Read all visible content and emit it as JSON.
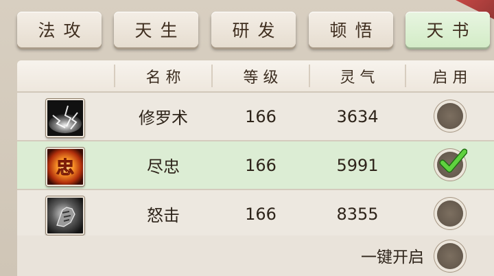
{
  "tabs": [
    {
      "label": "法攻",
      "active": false
    },
    {
      "label": "天生",
      "active": false
    },
    {
      "label": "研发",
      "active": false
    },
    {
      "label": "顿悟",
      "active": false
    },
    {
      "label": "天书",
      "active": true
    }
  ],
  "table": {
    "headers": [
      "",
      "名称",
      "等级",
      "灵气",
      "启用"
    ],
    "rows": [
      {
        "icon": "lightning-skill-icon",
        "name": "修罗术",
        "level": "166",
        "qi": "3634",
        "enabled": false
      },
      {
        "icon": "loyalty-zhong-skill-icon",
        "icon_glyph": "忠",
        "name": "尽忠",
        "level": "166",
        "qi": "5991",
        "enabled": true
      },
      {
        "icon": "fist-strike-skill-icon",
        "name": "怒击",
        "level": "166",
        "qi": "8355",
        "enabled": false
      }
    ]
  },
  "footer": {
    "enable_all_label": "一键开启"
  },
  "colors": {
    "selected_row": "#dcedd4",
    "check_green": "#3fae2a",
    "radio_fill": "#6b5f52",
    "active_tab": "#d3ecc7"
  }
}
